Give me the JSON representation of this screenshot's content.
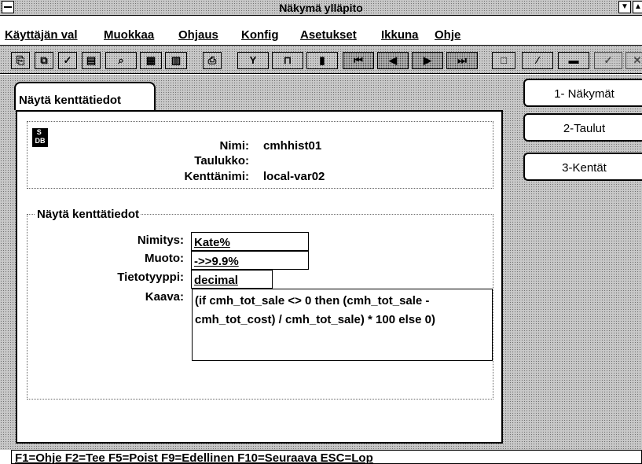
{
  "window": {
    "title": "Näkymä ylläpito",
    "min_glyph": "▼",
    "max_glyph": "▲"
  },
  "menu": [
    {
      "label": "Käyttäjän val"
    },
    {
      "label": "Muokkaa"
    },
    {
      "label": "Ohjaus"
    },
    {
      "label": "Konfig"
    },
    {
      "label": "Asetukset"
    },
    {
      "label": "Ikkuna"
    },
    {
      "label": "Ohje"
    }
  ],
  "toolbar": [
    {
      "icon": "copy-icon",
      "glyph": "⎘"
    },
    {
      "icon": "paste-icon",
      "glyph": "⧉"
    },
    {
      "icon": "check-doc-icon",
      "glyph": "✓"
    },
    {
      "icon": "edit-doc-icon",
      "glyph": "▤"
    },
    {
      "icon": "search-icon",
      "glyph": "⌕"
    },
    {
      "icon": "grid-icon",
      "glyph": "▦"
    },
    {
      "icon": "table-icon",
      "glyph": "▥"
    },
    {
      "icon": "print-icon",
      "glyph": "⎙"
    },
    {
      "icon": "filter-icon",
      "glyph": "Y"
    },
    {
      "icon": "sort-icon",
      "glyph": "⊓"
    },
    {
      "icon": "columns-icon",
      "glyph": "▮"
    },
    {
      "icon": "first-record-icon",
      "glyph": "⏮"
    },
    {
      "icon": "prev-record-icon",
      "glyph": "◀"
    },
    {
      "icon": "next-record-icon",
      "glyph": "▶"
    },
    {
      "icon": "last-record-icon",
      "glyph": "⏭"
    },
    {
      "icon": "new-record-icon",
      "glyph": "□"
    },
    {
      "icon": "edit-record-icon",
      "glyph": "∕"
    },
    {
      "icon": "delete-record-icon",
      "glyph": "▬"
    },
    {
      "icon": "accept-icon",
      "glyph": "✓"
    },
    {
      "icon": "cancel-icon",
      "glyph": "✕"
    }
  ],
  "tab": {
    "label": "Näytä kenttätiedot"
  },
  "info": {
    "icon_text": "SA\nDB",
    "nimi_label": "Nimi:",
    "nimi_value": "cmhhist01",
    "taulukko_label": "Taulukko:",
    "taulukko_value": "",
    "kenttanimi_label": "Kenttänimi:",
    "kenttanimi_value": "local-var02"
  },
  "details": {
    "title": "Näytä kenttätiedot",
    "nimitys_label": "Nimitys:",
    "nimitys_value": "Kate%",
    "muoto_label": "Muoto:",
    "muoto_value": "->>9.9%",
    "tietotyyppi_label": "Tietotyyppi:",
    "tietotyyppi_value": "decimal",
    "kaava_label": "Kaava:",
    "kaava_value": "(if cmh_tot_sale <> 0 then (cmh_tot_sale - cmh_tot_cost) / cmh_tot_sale) * 100 else 0)"
  },
  "nav": [
    {
      "label": "1- Näkymät"
    },
    {
      "label": "2-Taulut"
    },
    {
      "label": "3-Kentät"
    }
  ],
  "status": {
    "text": "F1=Ohje  F2=Tee  F5=Poist  F9=Edellinen  F10=Seuraava  ESC=Lop"
  }
}
